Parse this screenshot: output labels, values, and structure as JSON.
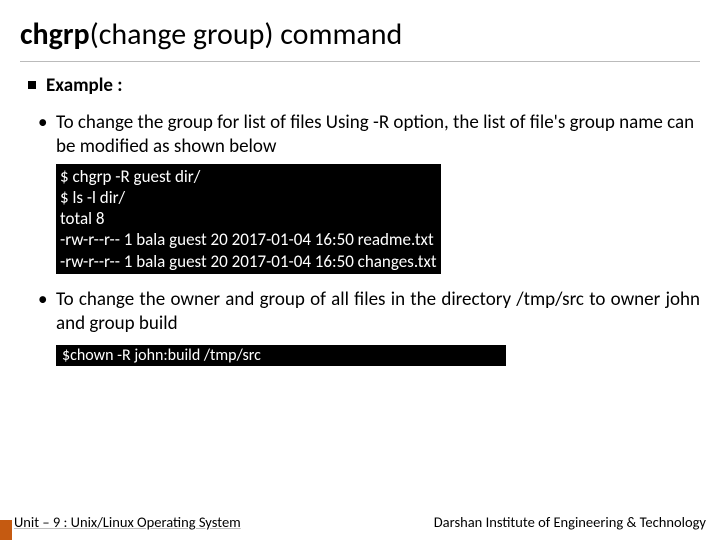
{
  "title_bold": "chgrp",
  "title_rest": "(change group) command",
  "example_label": "Example :",
  "bullet1": "To change the group for list of files Using -R option, the list of file's group name can be modified as shown below",
  "term1": {
    "l1": "$ chgrp -R guest dir/",
    "l2": "$ ls -l dir/",
    "l3": "total 8",
    "l4": "-rw-r--r-- 1 bala guest 20 2017-01-04 16:50 readme.txt",
    "l5": "-rw-r--r-- 1 bala guest 20 2017-01-04 16:50 changes.txt"
  },
  "bullet2": "To change the owner and group of all files in the directory /tmp/src to owner john and group build",
  "term2": "$chown -R john:build /tmp/src",
  "footer_left": "Unit – 9  : Unix/Linux Operating System",
  "footer_right": "Darshan Institute of Engineering & Technology"
}
